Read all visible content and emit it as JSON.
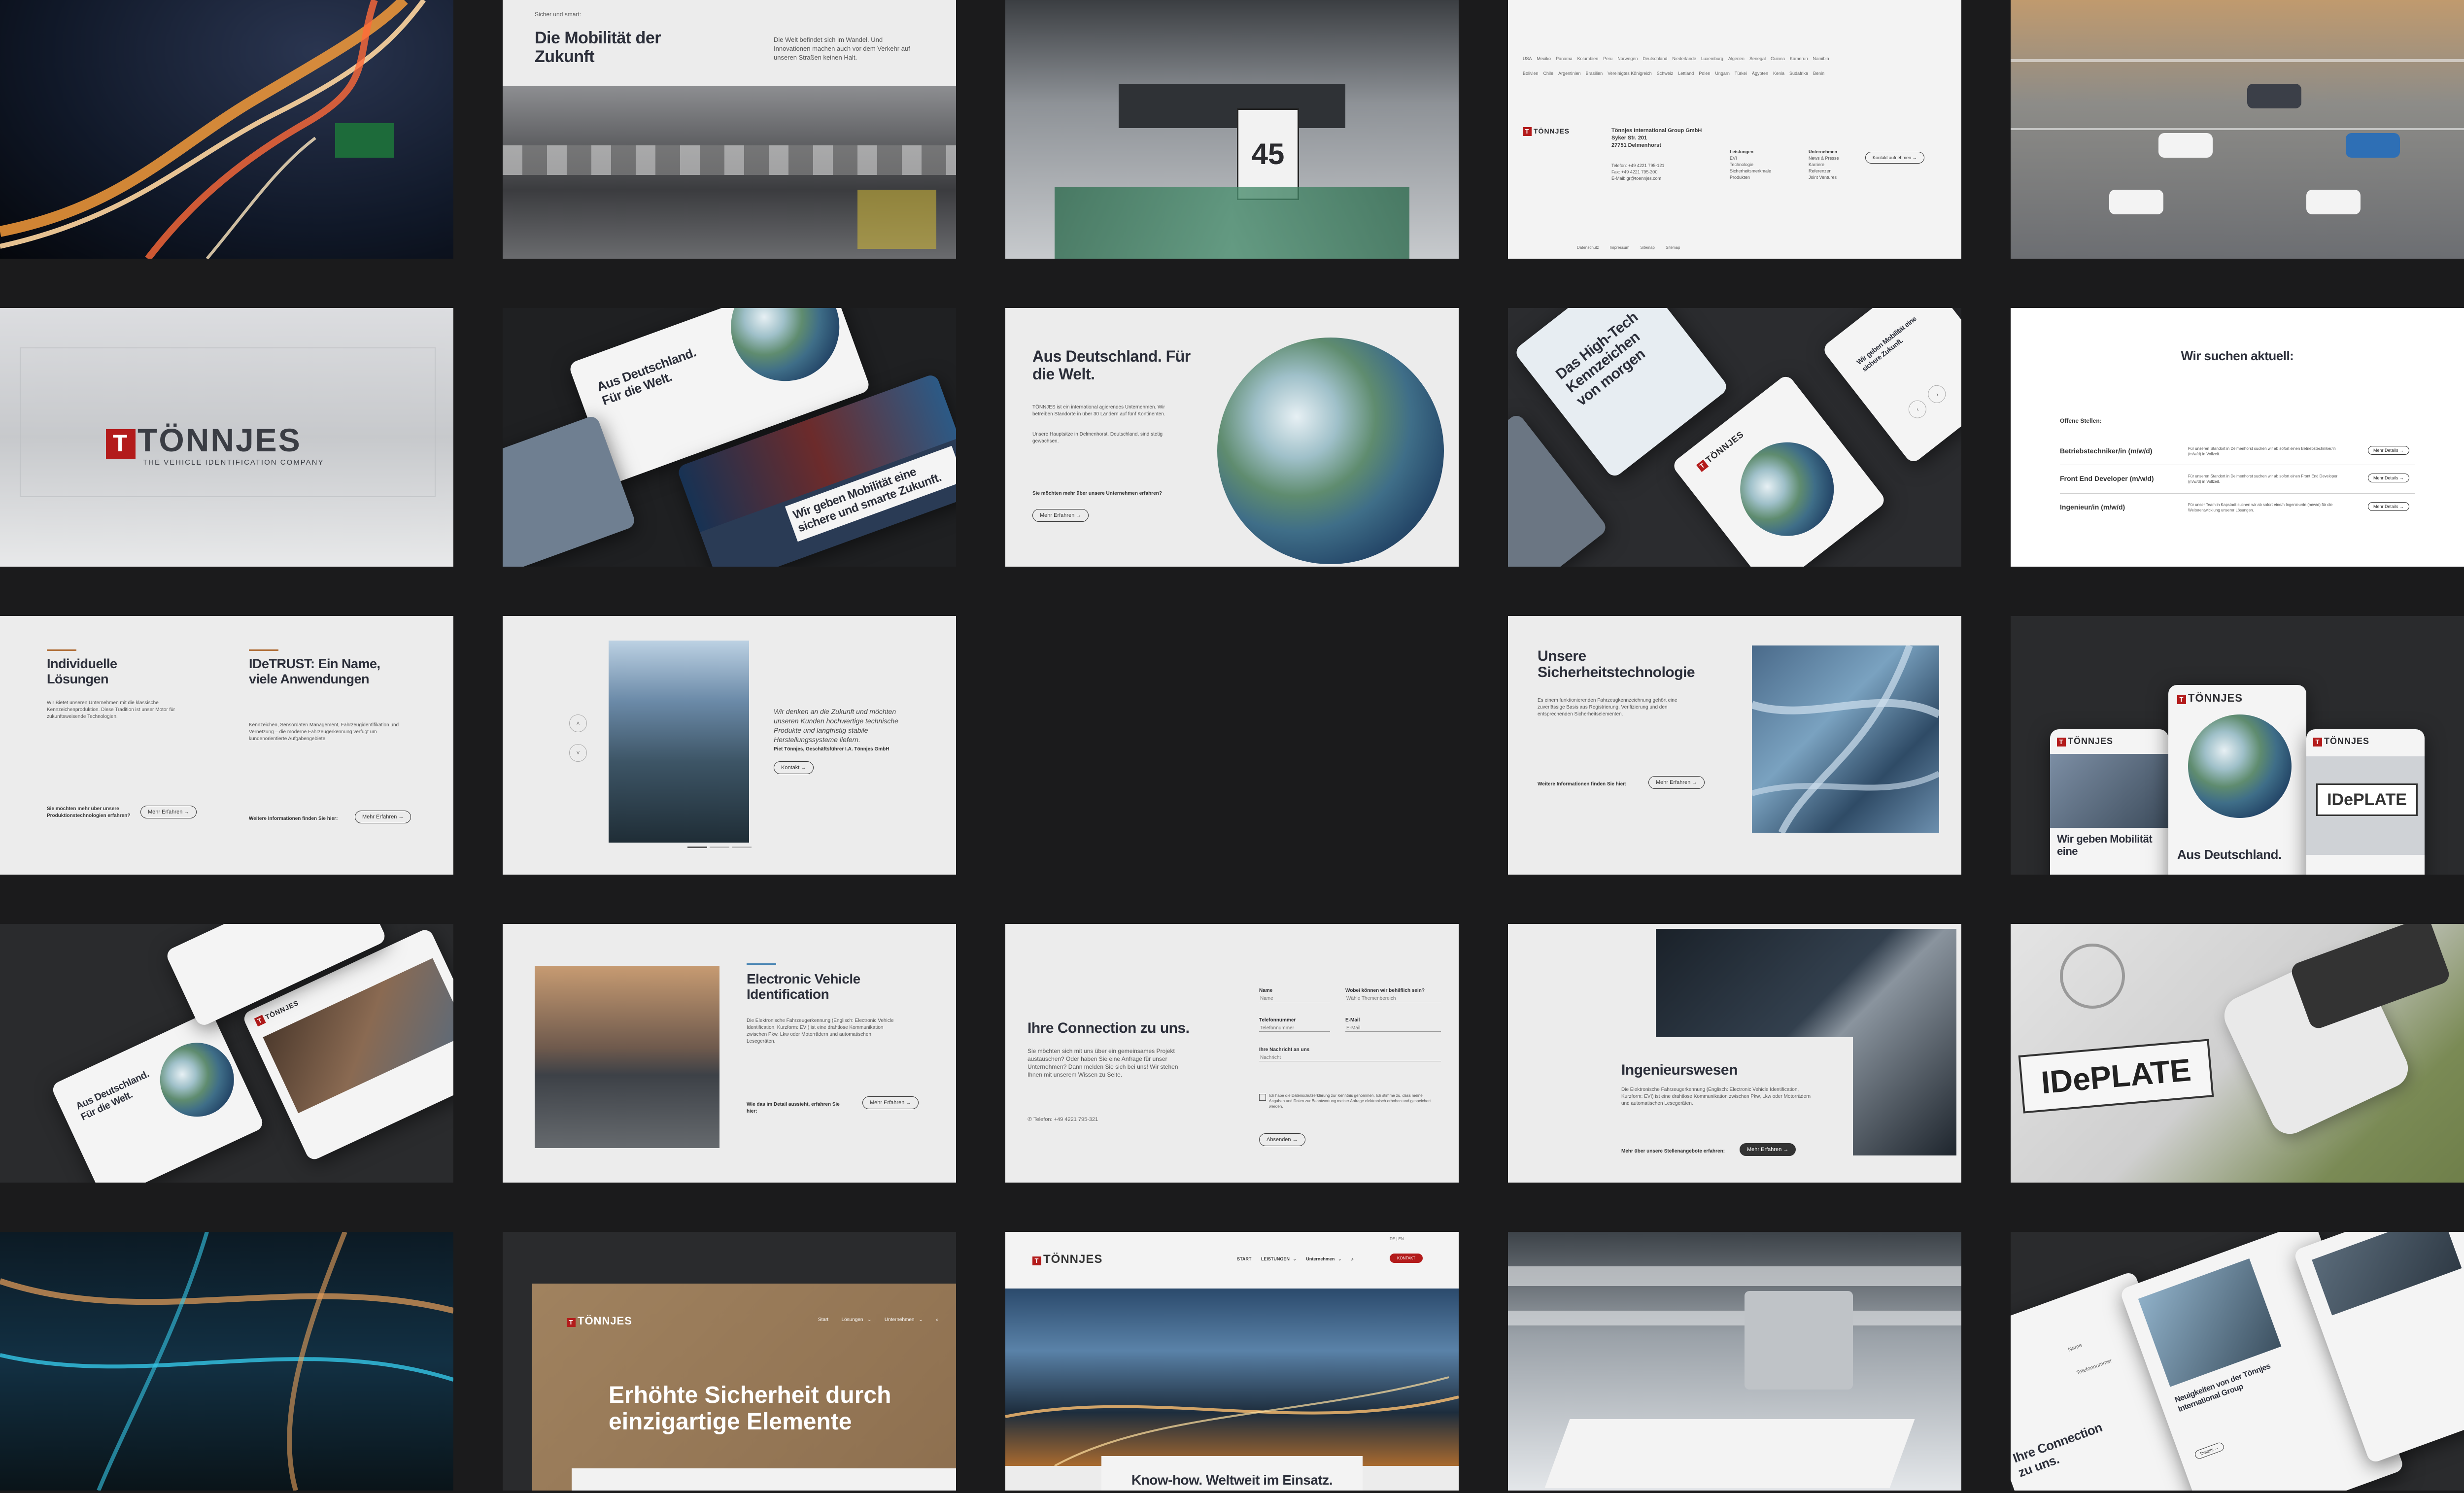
{
  "brand": {
    "name": "TÖNNJES",
    "tagline": "THE VEHICLE IDENTIFICATION COMPANY",
    "accent": "#b31b1b",
    "bronze": "#b0703a",
    "dark": "#1b1b1c"
  },
  "mobility": {
    "eyebrow": "Sicher und smart:",
    "title": "Die Mobilität der Zukunft",
    "text": "Die Welt befindet sich im Wandel. Und Innovationen machen auch vor dem Verkehr auf unseren Straßen keinen Halt."
  },
  "footer": {
    "company": "Tönnjes International Group GmbH",
    "street": "Syker Str. 201",
    "city": "27751 Delmenhorst",
    "phone": "Telefon: +49 4221 795-121",
    "fax": "Fax: +49 4221 795-300",
    "email": "E-Mail: gr@toennjes.com",
    "col1_title": "Leistungen",
    "col1": [
      "EVI",
      "Technologie",
      "Sicherheitsmerkmale",
      "Produkten"
    ],
    "col2_title": "Unternehmen",
    "col2": [
      "News & Presse",
      "Karriere",
      "Referenzen",
      "Joint Ventures"
    ],
    "cta": "Kontakt aufnehmen →",
    "legal": [
      "Datenschutz",
      "Impressum",
      "Sitemap",
      "Sitemap"
    ],
    "countries": [
      "USA",
      "Mexiko",
      "Panama",
      "Kolumbien",
      "Peru",
      "Norwegen",
      "Deutschland",
      "Niederlande",
      "Luxemburg",
      "Algerien",
      "Senegal",
      "Guinea",
      "Kamerun",
      "Namibia",
      "Bolivien",
      "Chile",
      "Argentinien",
      "Brasilien",
      "Vereinigtes Königreich",
      "Schweiz",
      "Lettland",
      "Polen",
      "Ungarn",
      "Türkei",
      "Ägypten",
      "Kenia",
      "Südafrika",
      "Benin"
    ]
  },
  "logo_tile": {
    "name": "TÖNNJES",
    "tagline": "THE VEHICLE IDENTIFICATION COMPANY"
  },
  "cards_tilted": {
    "headline_a": "Aus Deutschland. Für die Welt.",
    "headline_b": "Wir geben Mobilität eine sichere und smarte Zukunft."
  },
  "germany": {
    "title": "Aus Deutschland. Für die Welt.",
    "p1": "TÖNNJES ist ein international agierendes Unternehmen. Wir betreiben Standorte in über 30 Ländern auf fünf Kontinenten.",
    "p2": "Unsere Hauptsitze in Delmenhorst, Deutschland, sind stetig gewachsen.",
    "question": "Sie möchten mehr über unsere Unternehmen erfahren?",
    "cta": "Mehr Erfahren →"
  },
  "hightech": {
    "headline_a": "Das High-Tech Kennzeichen von morgen",
    "headline_b": "Wir geben Mobilität eine sichere Zukunft.",
    "headline_c": "Aus Deutschland. Für die Welt."
  },
  "jobs": {
    "title": "Wir suchen aktuell:",
    "open_label": "Offene Stellen:",
    "items": [
      {
        "title": "Betriebstechniker/in (m/w/d)",
        "desc": "Für unseren Standort in Delmenhorst suchen wir ab sofort einen Betriebstechniker/in (m/w/d) in Vollzeit.",
        "cta": "Mehr Details →"
      },
      {
        "title": "Front End Developer (m/w/d)",
        "desc": "Für unseren Standort in Delmenhorst suchen wir ab sofort einen Front End Developer (m/w/d) in Vollzeit.",
        "cta": "Mehr Details →"
      },
      {
        "title": "Ingenieur/in (m/w/d)",
        "desc": "Für unser Team in Kapstadt suchen wir ab sofort eine/n Ingenieur/in (m/w/d) für die Weiterentwicklung unserer Lösungen.",
        "cta": "Mehr Details →"
      }
    ]
  },
  "solutions": {
    "left_title": "Individuelle Lösungen",
    "left_text": "Wir Bietet unseren Unternehmen mit die klassische Kennzeichenproduktion. Diese Tradition ist unser Motor für zukunftsweisende Technologien.",
    "left_question": "Sie möchten mehr über unsere Produktionstechnologien erfahren?",
    "left_cta": "Mehr Erfahren →",
    "right_title": "IDeTRUST: Ein Name, viele Anwendungen",
    "right_text": "Kennzeichen, Sensordaten Management, Fahrzeugidentifikation und Vernetzung – die moderne Fahrzeugerkennung verfügt um kundenorientierte Aufgabengebiete.",
    "right_question": "Weitere Informationen finden Sie hier:",
    "right_cta": "Mehr Erfahren →"
  },
  "quote": {
    "text": "Wir denken an die Zukunft und möchten unseren Kunden hochwertige technische Produkte und langfristig stabile Herstellungssysteme liefern.",
    "author": "Piet Tönnjes, Geschäftsführer I.A. Tönnjes GmbH",
    "cta": "Kontakt →"
  },
  "security": {
    "title": "Unsere Sicherheitstechnologie",
    "text": "Es einem funktionierenden Fahrzeugkennzeichnung gehört eine zuverlässige Basis aus Registrierung, Verifizierung und den entsprechenden Sicherheitselementen.",
    "question": "Weitere Informationen finden Sie hier:",
    "cta": "Mehr Erfahren →"
  },
  "mobile": {
    "headline_a": "Wir geben Mobilität eine",
    "headline_b": "Aus Deutschland.",
    "plate": "IDePLATE"
  },
  "evi": {
    "title": "Electronic Vehicle Identification",
    "text": "Die Elektronische Fahrzeugerkennung (Englisch: Electronic Vehicle Identification, Kurzform: EVI) ist eine drahtlose Kommunikation zwischen Pkw, Lkw oder Motorrädern und automatischen Lesegeräten.",
    "question": "Wie das im Detail aussieht, erfahren Sie hier:",
    "cta": "Mehr Erfahren →"
  },
  "contact": {
    "title": "Ihre Connection zu uns.",
    "text": "Sie möchten sich mit uns über ein gemeinsames Projekt austauschen? Oder haben Sie eine Anfrage für unser Unternehmen? Dann melden Sie sich bei uns! Wir stehen Ihnen mit unserem Wissen zu Seite.",
    "phone": "Telefon: +49 4221 795-321",
    "f_name": "Name",
    "f_name_ph": "Name",
    "f_topic": "Wobei können wir behilflich sein?",
    "f_topic_ph": "Wähle Themenbereich",
    "f_phone": "Telefonnummer",
    "f_phone_ph": "Telefonnummer",
    "f_email": "E-Mail",
    "f_email_ph": "E-Mail",
    "f_msg": "Ihre Nachricht an uns",
    "f_msg_ph": "Nachricht",
    "consent": "Ich habe die Datenschutzerklärung zur Kenntnis genommen. Ich stimme zu, dass meine Angaben und Daten zur Beantwortung meiner Anfrage elektronisch erhoben und gespeichert werden.",
    "cta": "Absenden →"
  },
  "engineering": {
    "title": "Ingenieurswesen",
    "text": "Die Elektronische Fahrzeugerkennung (Englisch: Electronic Vehicle Identification, Kurzform: EVI) ist eine drahtlose Kommunikation zwischen Pkw, Lkw oder Motorrädern und automatischen Lesegeräten.",
    "question": "Mehr über unsere Stellenangebote erfahren:",
    "cta": "Mehr Erfahren →"
  },
  "plate_tile": {
    "plate": "IDePLATE"
  },
  "hero_brown": {
    "nav": [
      "Start",
      "Lösungen ⌄",
      "Unternehmen ⌄"
    ],
    "headline": "Erhöhte Sicherheit durch einzigartige Elemente"
  },
  "hero_city": {
    "nav": [
      "START",
      "LEISTUNGEN ⌄",
      "Unternehmen ⌄"
    ],
    "lang": "DE | EN",
    "cta": "KONTAKT",
    "headline": "Know-how. Weltweit im Einsatz."
  },
  "news": {
    "title": "Neuigkeiten von der Tönnjes International Group",
    "headline_b": "Ihre Connection zu uns.",
    "f_name": "Name",
    "f_phone": "Telefonnummer",
    "cta": "Details →"
  }
}
